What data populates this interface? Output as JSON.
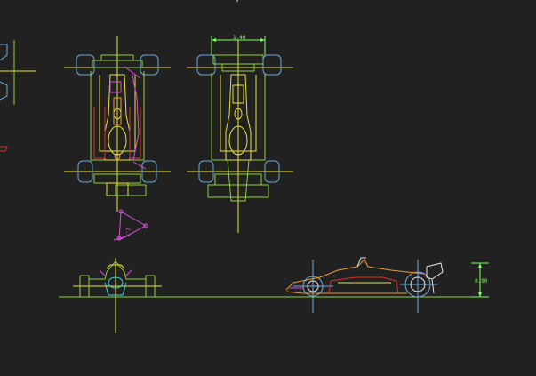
{
  "drawing": {
    "background": "#212121",
    "dimensions": {
      "front_track": "1.40",
      "rear_wing_height": "0.90",
      "marker_label": "2.4"
    },
    "colors": {
      "body_yellow": "#e8e23a",
      "body_green": "#8ecf3f",
      "tire_blue": "#6fa8d6",
      "dim_green": "#7dff5a",
      "red": "#d6342c",
      "magenta": "#d64fd6",
      "orange": "#e89a3a",
      "cyan": "#3fd6d6",
      "white": "#e6e6e6"
    },
    "views": [
      "top-view-left",
      "top-view-right",
      "front-view",
      "side-view"
    ]
  }
}
